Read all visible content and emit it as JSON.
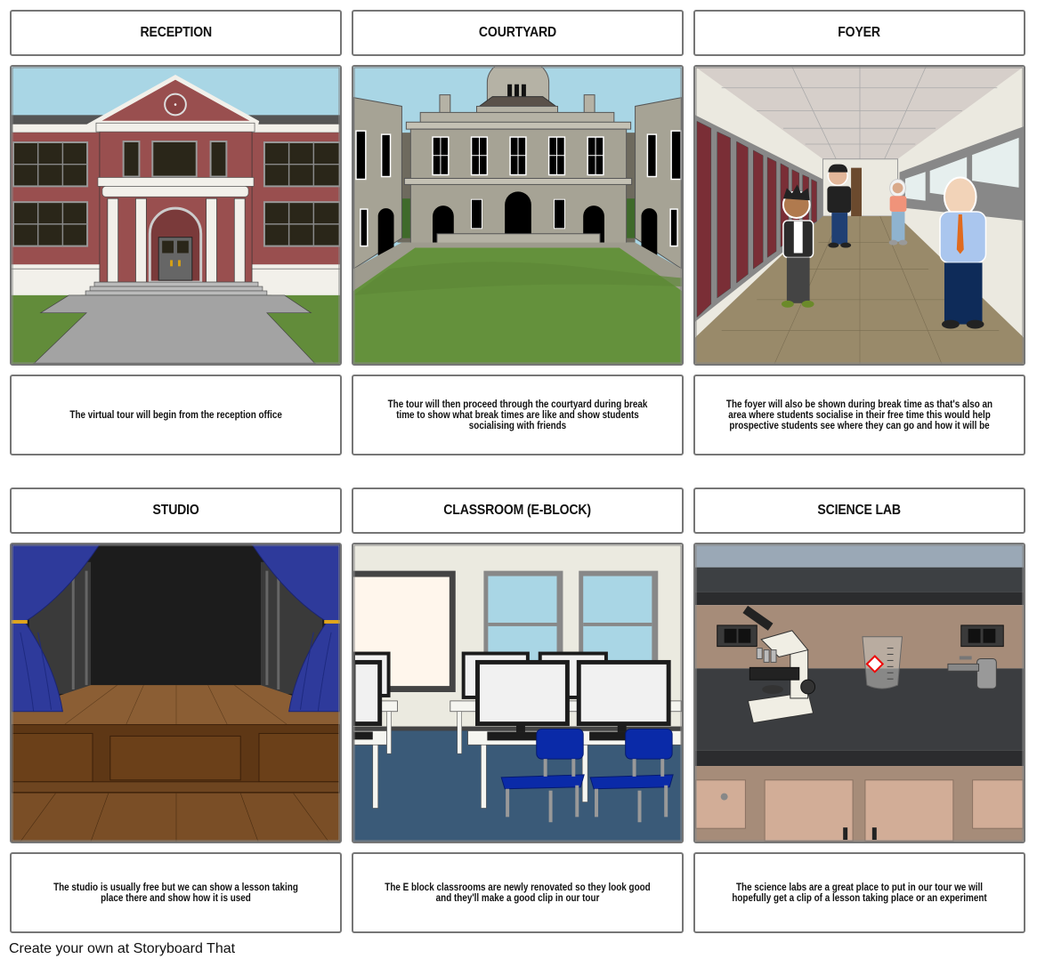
{
  "storyboard": {
    "cells": [
      {
        "title": "RECEPTION",
        "scene": "school-building-exterior",
        "description": "The virtual tour will begin from the reception office"
      },
      {
        "title": "COURTYARD",
        "scene": "courtyard-lawn",
        "description": "The tour will then proceed through the courtyard during break time to show what break times are like and show students socialising with friends"
      },
      {
        "title": "FOYER",
        "scene": "school-hallway-lockers",
        "description": "The foyer will also be shown during break time as that's also an area where students socialise in their free time this would help prospective students see where they can go and how it will be"
      },
      {
        "title": "STUDIO",
        "scene": "theatre-stage-curtains",
        "description": "The studio is usually free but we can show a lesson taking place there and show how it is used"
      },
      {
        "title": "CLASSROOM (E-BLOCK)",
        "scene": "computer-classroom",
        "description": "The E block classrooms are newly renovated so they look good and they'll make a good clip in our tour"
      },
      {
        "title": "SCIENCE LAB",
        "scene": "lab-bench-microscope",
        "description": "The science labs are a great place to put in our tour we will hopefully get a clip of a lesson taking place or an experiment"
      }
    ]
  },
  "footer": {
    "text": "Create your own at Storyboard That"
  }
}
